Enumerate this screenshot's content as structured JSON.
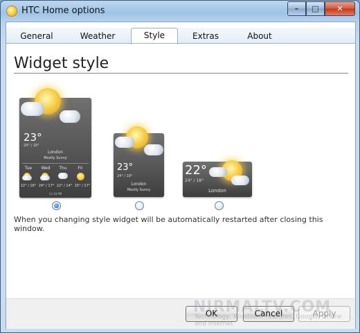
{
  "window": {
    "title": "HTC Home options"
  },
  "tabs": [
    {
      "label": "General"
    },
    {
      "label": "Weather"
    },
    {
      "label": "Style"
    },
    {
      "label": "Extras"
    },
    {
      "label": "About"
    }
  ],
  "page": {
    "heading": "Widget style",
    "note": "When you changing style widget will be automatically restarted after closing this window."
  },
  "styles": [
    {
      "selected": true,
      "temp": "23°",
      "range": "29° / 18°",
      "city": "London",
      "condition": "Mostly Sunny",
      "forecast": [
        {
          "day": "Tue",
          "temps": "22° / 16°"
        },
        {
          "day": "Wed",
          "temps": "24° / 17°"
        },
        {
          "day": "Thu",
          "temps": "22° / 14°"
        },
        {
          "day": "Fri",
          "temps": "25° / 17°"
        }
      ],
      "updated": "12:18 PM"
    },
    {
      "selected": false,
      "temp": "23°",
      "range": "24° / 18°",
      "city": "London",
      "condition": "Mostly Sunny"
    },
    {
      "selected": false,
      "temp": "22°",
      "range": "24° / 18°",
      "city": "London"
    }
  ],
  "buttons": {
    "ok": "OK",
    "cancel": "Cancel",
    "apply": "Apply"
  },
  "watermark": {
    "text": "NIRMALTV.COM",
    "sub": "Technology, Windows, Features, Google, Online and Internet"
  },
  "window_buttons": {
    "minimize": "–",
    "maximize": "□",
    "close": "✕"
  }
}
